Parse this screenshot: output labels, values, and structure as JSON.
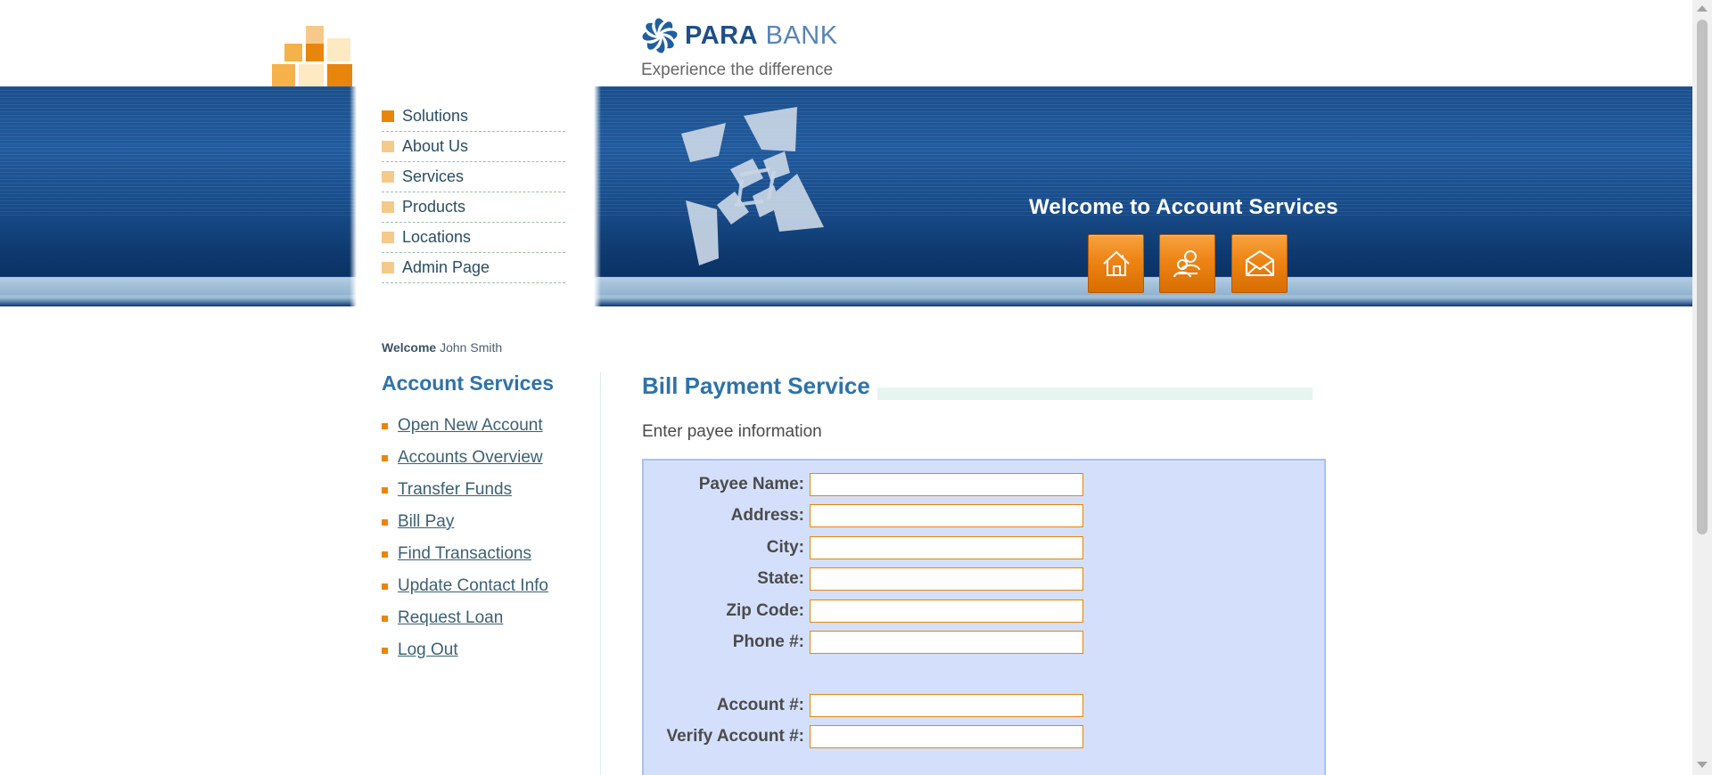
{
  "brand": {
    "name_bold": "PARA",
    "name_light": "BANK",
    "tagline": "Experience the difference"
  },
  "main_menu": [
    {
      "label": "Solutions",
      "active": true
    },
    {
      "label": "About Us",
      "active": false
    },
    {
      "label": "Services",
      "active": false
    },
    {
      "label": "Products",
      "active": false
    },
    {
      "label": "Locations",
      "active": false
    },
    {
      "label": "Admin Page",
      "active": false
    }
  ],
  "header": {
    "welcome_title": "Welcome to Account Services",
    "buttons": [
      {
        "name": "home",
        "icon": "home-icon"
      },
      {
        "name": "about",
        "icon": "people-icon"
      },
      {
        "name": "contact",
        "icon": "envelope-icon"
      }
    ]
  },
  "user": {
    "welcome_label": "Welcome",
    "full_name": "John Smith"
  },
  "account_services": {
    "title": "Account Services",
    "links": [
      "Open New Account",
      "Accounts Overview",
      "Transfer Funds",
      "Bill Pay",
      "Find Transactions",
      "Update Contact Info",
      "Request Loan",
      "Log Out"
    ]
  },
  "bill_pay": {
    "title": "Bill Payment Service",
    "subtitle": "Enter payee information",
    "fields": {
      "payee_name": {
        "label": "Payee Name:",
        "value": ""
      },
      "address": {
        "label": "Address:",
        "value": ""
      },
      "city": {
        "label": "City:",
        "value": ""
      },
      "state": {
        "label": "State:",
        "value": ""
      },
      "zip_code": {
        "label": "Zip Code:",
        "value": ""
      },
      "phone": {
        "label": "Phone #:",
        "value": ""
      },
      "account": {
        "label": "Account #:",
        "value": ""
      },
      "verify_account": {
        "label": "Verify Account #:",
        "value": ""
      }
    }
  },
  "colors": {
    "accent_orange": "#e8850d",
    "header_blue": "#1b4f8b",
    "title_blue": "#2e73a8",
    "form_background": "#d4e0fb"
  }
}
